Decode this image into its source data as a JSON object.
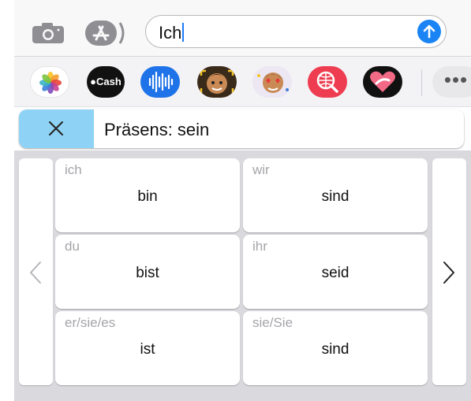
{
  "composer": {
    "message_text": "Ich",
    "icons": {
      "camera": "camera-icon",
      "appstore": "appstore-icon",
      "send": "arrow-up-icon"
    }
  },
  "app_strip": {
    "apps": [
      {
        "name": "Photos",
        "icon": "photos-icon"
      },
      {
        "name": "Apple Cash",
        "label": "Cash",
        "icon": "apple-cash-icon"
      },
      {
        "name": "Audio",
        "icon": "audio-waveform-icon"
      },
      {
        "name": "Memoji",
        "icon": "memoji-icon"
      },
      {
        "name": "Memoji Stickers",
        "icon": "memoji-stickers-icon"
      },
      {
        "name": "Search",
        "icon": "web-search-icon"
      },
      {
        "name": "Digital Touch",
        "icon": "heart-icon"
      }
    ],
    "more_label": "•••"
  },
  "conjugation": {
    "title": "Präsens: sein",
    "accent_color": "#8ed2f5",
    "cells": [
      {
        "pronoun": "ich",
        "verb": "bin"
      },
      {
        "pronoun": "wir",
        "verb": "sind"
      },
      {
        "pronoun": "du",
        "verb": "bist"
      },
      {
        "pronoun": "ihr",
        "verb": "seid"
      },
      {
        "pronoun": "er/sie/es",
        "verb": "ist"
      },
      {
        "pronoun": "sie/Sie",
        "verb": "sind"
      }
    ]
  }
}
